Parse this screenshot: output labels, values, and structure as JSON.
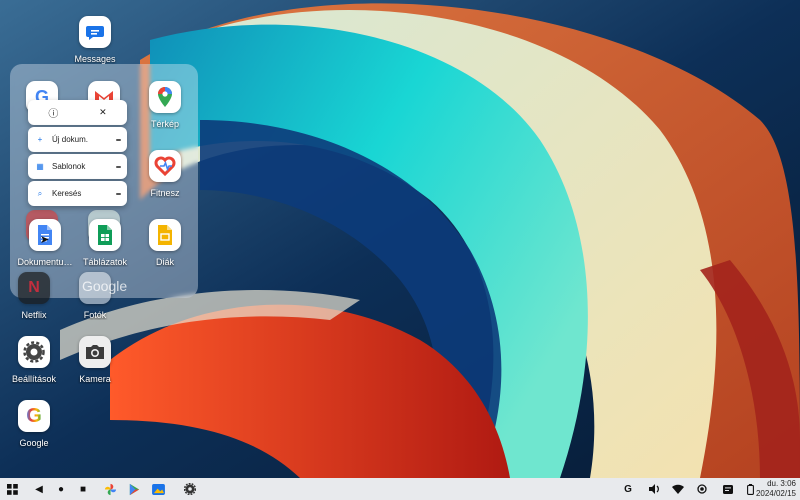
{
  "colors": {
    "wallpaper_dark": "#0b2a4a",
    "teal": "#17d2d4",
    "cream": "#f2e6b6",
    "orange": "#e8602c",
    "red": "#d7261d",
    "taskbar": "#e8eaed"
  },
  "desktop": {
    "messages": {
      "label": "Messages",
      "icon": "messages-icon"
    },
    "terkep": {
      "label": "Térkép",
      "icon": "maps-icon"
    },
    "fitnesz": {
      "label": "Fitnesz",
      "icon": "fit-icon"
    },
    "dokumentumok": {
      "label": "Dokumentu…",
      "icon": "docs-icon"
    },
    "tablazatok": {
      "label": "Táblázatok",
      "icon": "sheets-icon"
    },
    "diak": {
      "label": "Diák",
      "icon": "slides-icon"
    },
    "netflix": {
      "label": "Netflix",
      "icon": "netflix-icon"
    },
    "fotok": {
      "label": "Fotók",
      "icon": "photos-icon"
    },
    "beallitasok": {
      "label": "Beállítások",
      "icon": "settings-icon"
    },
    "kamera": {
      "label": "Kamera",
      "icon": "camera-icon"
    },
    "google": {
      "label": "Google",
      "icon": "google-icon"
    },
    "ghost_google": "Google"
  },
  "context_menu": {
    "info_icon": "ⓘ",
    "close_icon": "✕",
    "items": [
      {
        "label": "Új dokum.",
        "icon": "plus-icon",
        "glyph": "+"
      },
      {
        "label": "Sablonok",
        "icon": "grid-icon",
        "glyph": "▦"
      },
      {
        "label": "Keresés",
        "icon": "search-icon",
        "glyph": "⌕"
      }
    ]
  },
  "taskbar": {
    "clock_time": "du. 3:06",
    "clock_date": "2024/02/15",
    "google_letter": "G"
  }
}
